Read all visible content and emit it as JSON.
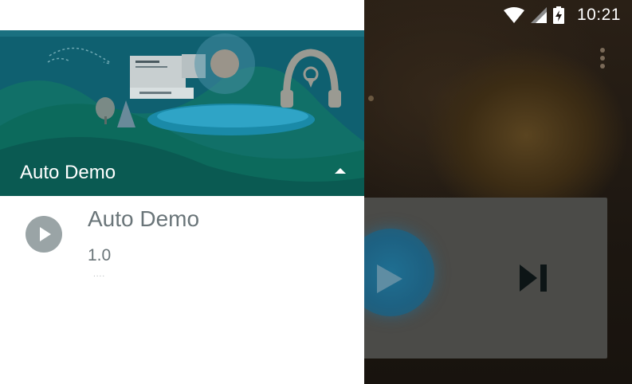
{
  "status_bar": {
    "time": "10:21",
    "icons": [
      "wifi-icon",
      "signal-icon",
      "battery-charging-icon"
    ]
  },
  "drawer": {
    "header": {
      "account_name": "Auto Demo",
      "expand_icon": "arrow-drop-up-icon"
    },
    "items": [
      {
        "icon": "play-circle-icon",
        "title": "Auto Demo",
        "version": "1.0",
        "dots": "...."
      }
    ]
  },
  "background_app": {
    "overflow_icon": "more-vert-icon",
    "controls": {
      "play_icon": "play-icon",
      "next_icon": "skip-next-icon"
    }
  },
  "colors": {
    "drawer_header": "#0e5a68",
    "status_bar_drawer": "#0b4d57",
    "scrim_card": "#4b4b48",
    "fab": "#1f6f92"
  }
}
